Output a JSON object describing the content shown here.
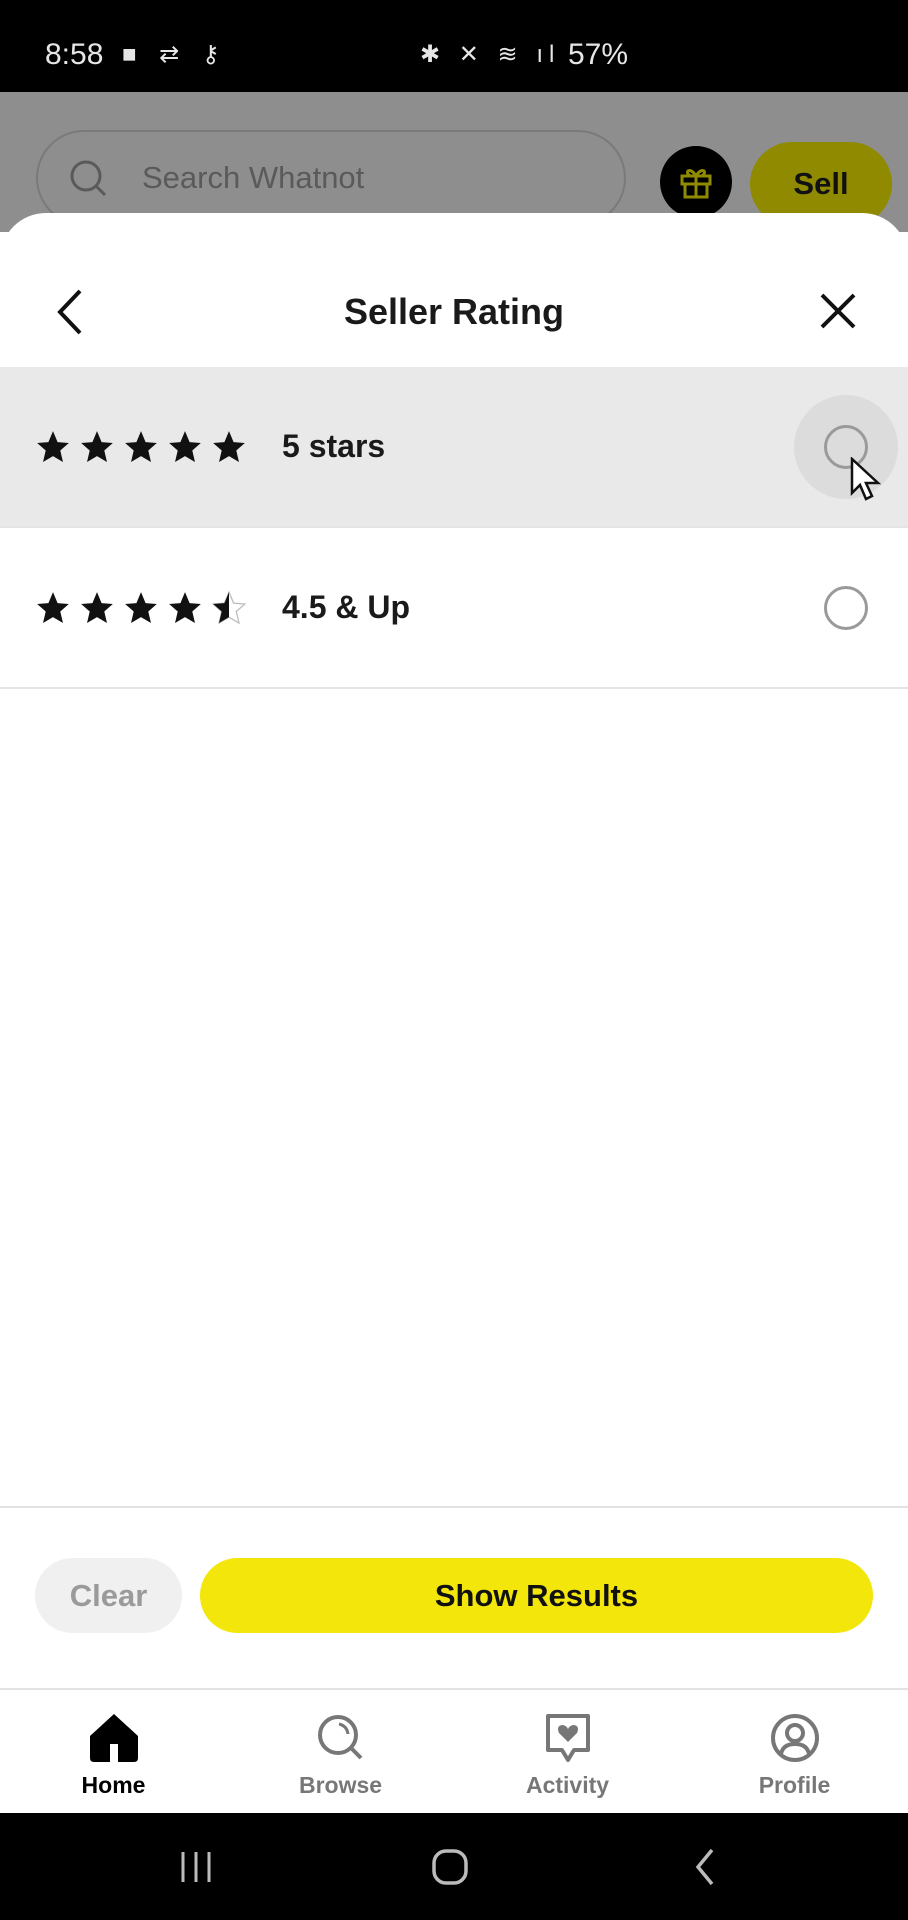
{
  "status_bar": {
    "time": "8:58",
    "battery": "57%"
  },
  "background": {
    "search_placeholder": "Search Whatnot",
    "sell_label": "Sell"
  },
  "sheet": {
    "title": "Seller Rating",
    "options": [
      {
        "label": "5 stars",
        "rating": 5,
        "selected": false
      },
      {
        "label": "4.5 & Up",
        "rating": 4.5,
        "selected": false
      }
    ],
    "clear_label": "Clear",
    "show_results_label": "Show Results"
  },
  "bottom_nav": {
    "items": [
      {
        "label": "Home",
        "active": true
      },
      {
        "label": "Browse"
      },
      {
        "label": "Activity"
      },
      {
        "label": "Profile"
      }
    ]
  },
  "colors": {
    "accent": "#f2e60a"
  }
}
